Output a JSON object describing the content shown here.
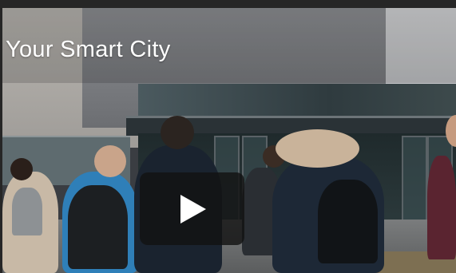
{
  "video": {
    "title": "Your Smart City",
    "play_icon": "play-icon"
  }
}
